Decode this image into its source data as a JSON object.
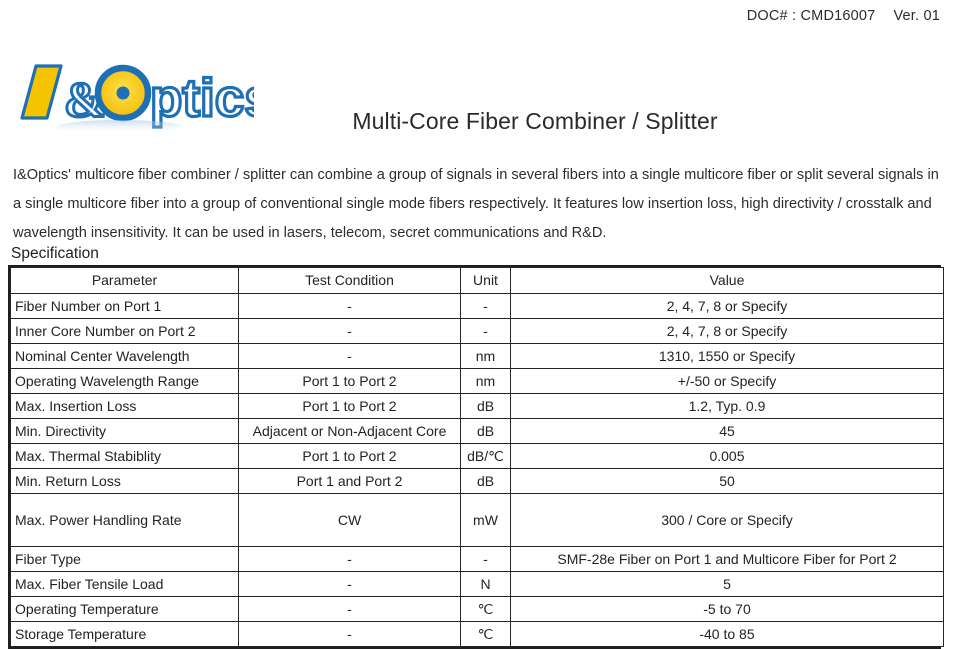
{
  "header": {
    "doc_number_label": "DOC# : CMD16007",
    "version_label": "Ver. 01"
  },
  "logo": {
    "brand_text": "I&Optics",
    "letter_i": "I",
    "ampersand": "&",
    "letters_ptics": "ptics",
    "colors": {
      "outline_blue": "#1f6fb5",
      "fill_yellow": "#f5c400",
      "dot_blue": "#1f6fb5",
      "light_blue": "#5a9bd4"
    }
  },
  "title": "Multi-Core Fiber Combiner / Splitter",
  "description": "I&Optics' multicore fiber combiner / splitter can combine a group of signals in several fibers into a single multicore fiber or split several signals in a single multicore fiber into a group of conventional single mode fibers respectively. It features low insertion loss, high directivity / crosstalk and wavelength insensitivity. It can be used in lasers, telecom, secret communications and R&D.",
  "spec_section_label": "Specification",
  "table": {
    "columns": [
      "Parameter",
      "Test Condition",
      "Unit",
      "Value"
    ],
    "rows": [
      {
        "parameter": "Fiber Number on Port 1",
        "test_condition": "-",
        "unit": "-",
        "value": "2, 4, 7, 8 or Specify",
        "tall": false
      },
      {
        "parameter": "Inner Core Number on Port 2",
        "test_condition": "-",
        "unit": "-",
        "value": "2, 4, 7, 8 or Specify",
        "tall": false
      },
      {
        "parameter": "Nominal Center Wavelength",
        "test_condition": "-",
        "unit": "nm",
        "value": "1310, 1550 or Specify",
        "tall": false
      },
      {
        "parameter": "Operating Wavelength Range",
        "test_condition": "Port 1 to Port 2",
        "unit": "nm",
        "value": "+/-50 or Specify",
        "tall": false
      },
      {
        "parameter": "Max. Insertion Loss",
        "test_condition": "Port 1 to Port 2",
        "unit": "dB",
        "value": "1.2, Typ. 0.9",
        "tall": false
      },
      {
        "parameter": "Min. Directivity",
        "test_condition": "Adjacent or Non-Adjacent Core",
        "unit": "dB",
        "value": "45",
        "tall": false
      },
      {
        "parameter": "Max. Thermal Stabiblity",
        "test_condition": "Port 1 to Port 2",
        "unit": "dB/℃",
        "value": "0.005",
        "tall": false
      },
      {
        "parameter": "Min. Return Loss",
        "test_condition": "Port 1 and Port 2",
        "unit": "dB",
        "value": "50",
        "tall": false
      },
      {
        "parameter": "Max. Power Handling Rate",
        "test_condition": "CW",
        "unit": "mW",
        "value": "300 / Core or Specify",
        "tall": true
      },
      {
        "parameter": "Fiber Type",
        "test_condition": "-",
        "unit": "-",
        "value": "SMF-28e Fiber on Port 1 and Multicore Fiber for Port 2",
        "tall": false
      },
      {
        "parameter": "Max. Fiber Tensile Load",
        "test_condition": "-",
        "unit": "N",
        "value": "5",
        "tall": false
      },
      {
        "parameter": "Operating Temperature",
        "test_condition": "-",
        "unit": "℃",
        "value": "-5 to 70",
        "tall": false
      },
      {
        "parameter": "Storage Temperature",
        "test_condition": "-",
        "unit": "℃",
        "value": "-40 to 85",
        "tall": false
      }
    ]
  }
}
